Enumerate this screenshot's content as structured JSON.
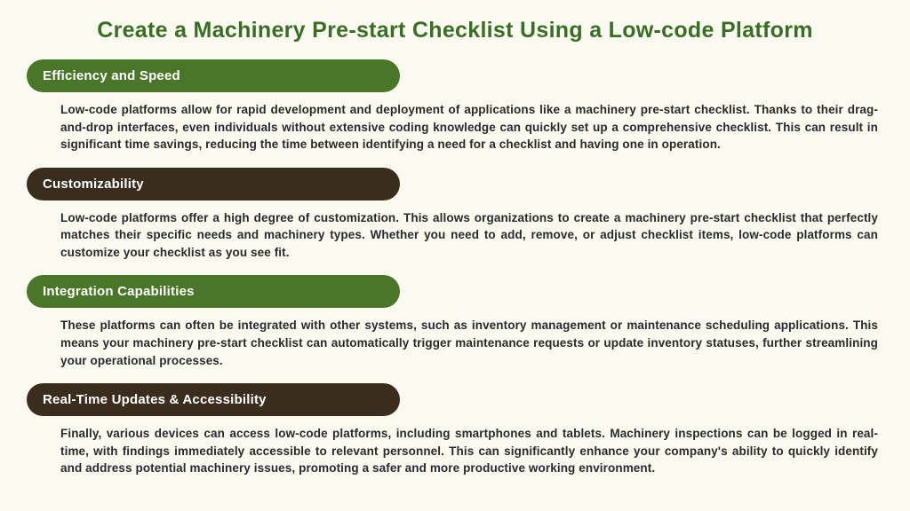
{
  "title": "Create a Machinery Pre-start Checklist Using a Low-code Platform",
  "sections": [
    {
      "heading": "Efficiency and Speed",
      "style": "green",
      "body": "Low-code platforms allow for rapid development and deployment of applications like a machinery pre-start checklist. Thanks to their drag-and-drop interfaces, even individuals without extensive coding knowledge can quickly set up a comprehensive checklist. This can result in significant time savings, reducing the time between identifying a need for a checklist and having one in operation."
    },
    {
      "heading": "Customizability",
      "style": "brown",
      "body": "Low-code platforms offer a high degree of customization. This allows organizations to create a machinery pre-start checklist that perfectly matches their specific needs and machinery types. Whether you need to add, remove, or adjust checklist items, low-code platforms can customize your checklist as you see fit."
    },
    {
      "heading": "Integration Capabilities",
      "style": "green",
      "body": "These platforms can often be integrated with other systems, such as inventory management or maintenance scheduling applications. This means your machinery pre-start checklist can automatically trigger maintenance requests or update inventory statuses, further streamlining your operational processes."
    },
    {
      "heading": "Real-Time Updates & Accessibility",
      "style": "brown",
      "body": "Finally, various devices can access low-code platforms, including smartphones and tablets. Machinery inspections can be logged in real-time, with findings immediately accessible to relevant personnel. This can significantly enhance your company's ability to quickly identify and address potential machinery issues, promoting a safer and more productive working environment."
    }
  ]
}
